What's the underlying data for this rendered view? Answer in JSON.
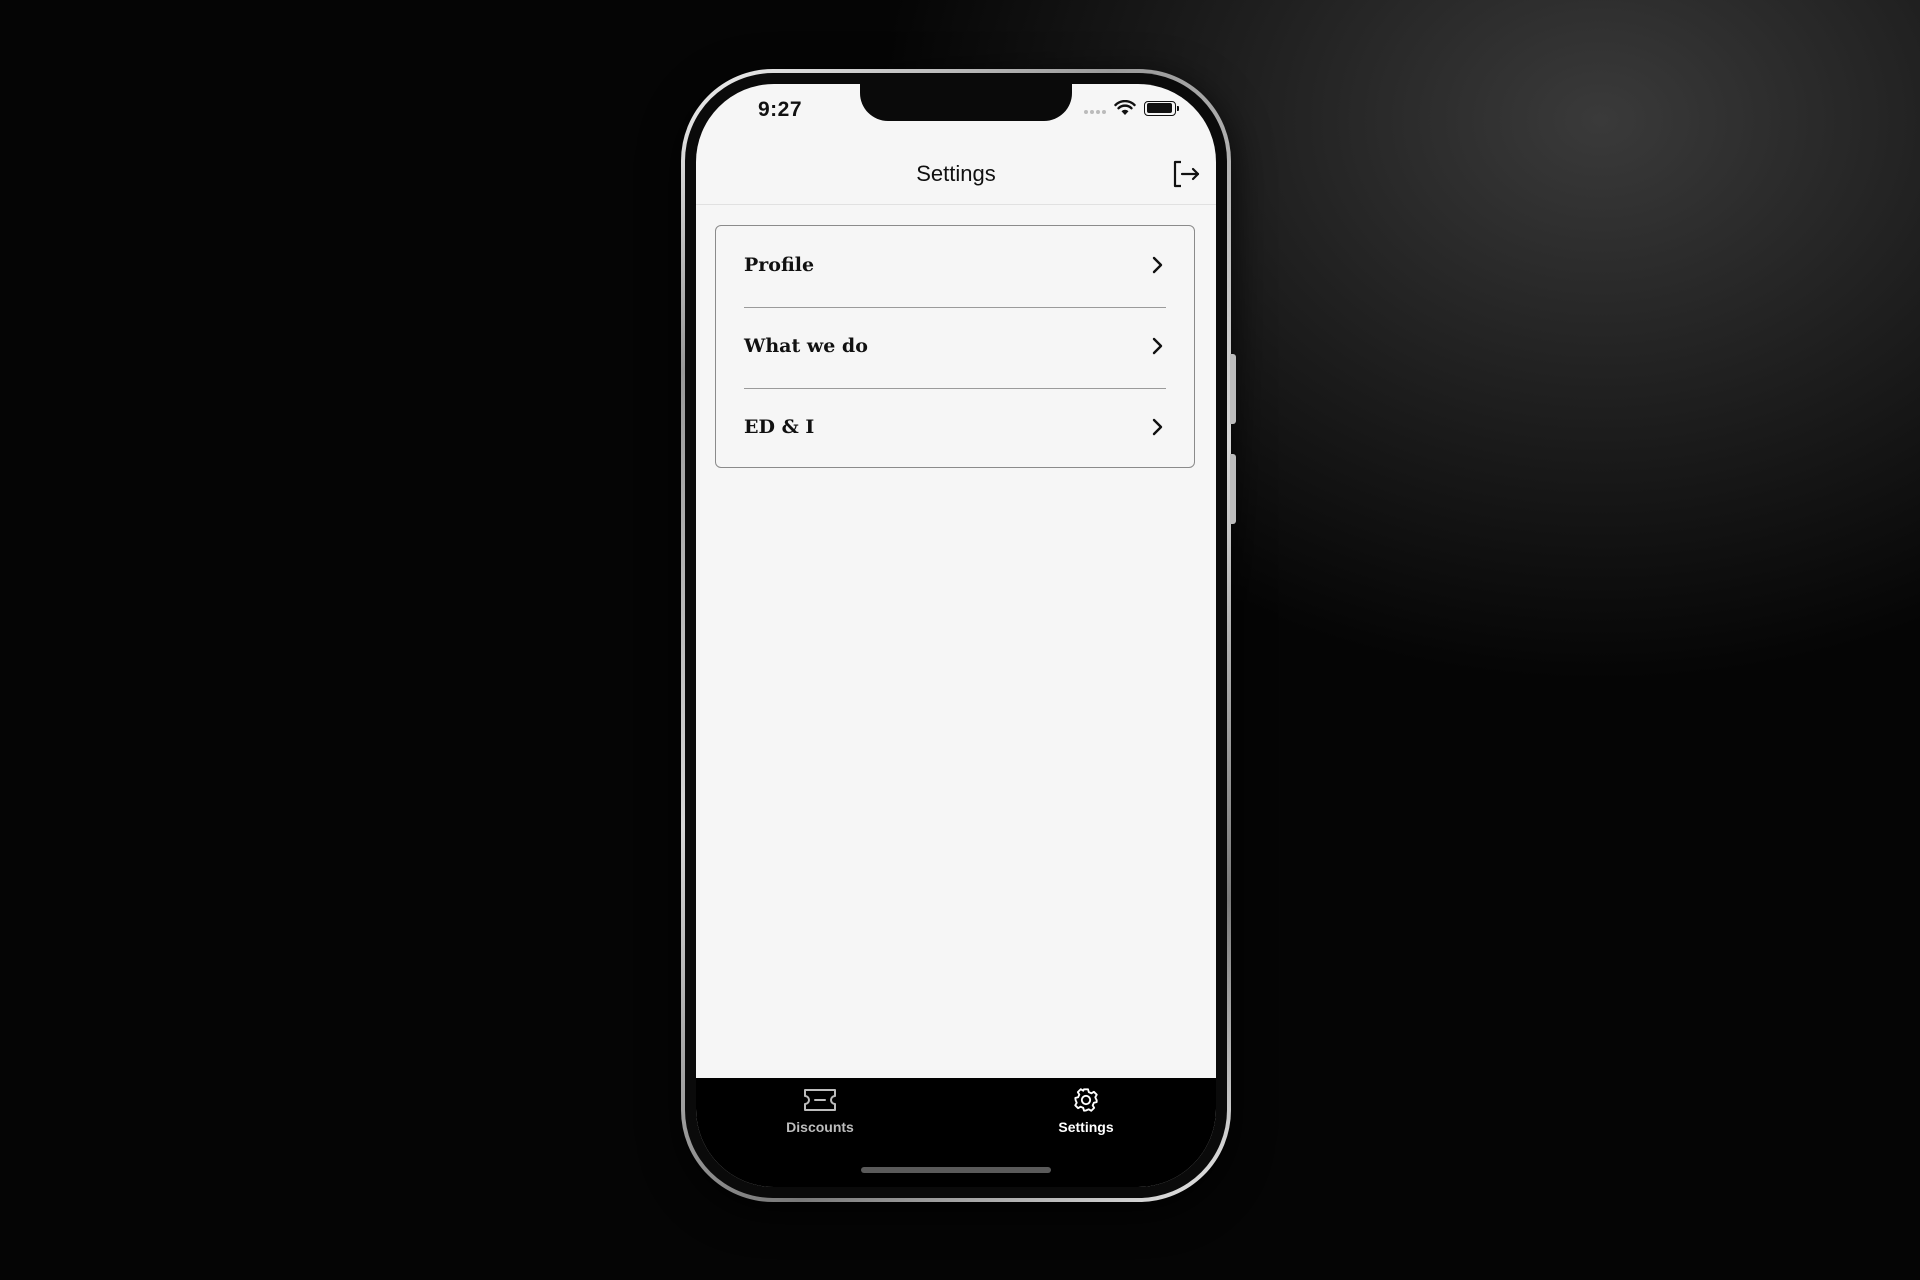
{
  "status_bar": {
    "time": "9:27"
  },
  "nav": {
    "title": "Settings",
    "action_icon": "logout-icon"
  },
  "menu": {
    "items": [
      {
        "label": "Profile",
        "icon": "chevron-right-icon"
      },
      {
        "label": "What we do",
        "icon": "chevron-right-icon"
      },
      {
        "label": "ED & I",
        "icon": "chevron-right-icon"
      }
    ]
  },
  "tab_bar": {
    "tabs": [
      {
        "label": "Discounts",
        "icon": "ticket-icon",
        "selected": false,
        "color": "#bdbdbd"
      },
      {
        "label": "Settings",
        "icon": "gear-icon",
        "selected": true,
        "color": "#ffffff"
      }
    ]
  },
  "colors": {
    "background": "#000000",
    "screen": "#f6f6f6",
    "tab_bar": "#000000",
    "text": "#111111"
  }
}
